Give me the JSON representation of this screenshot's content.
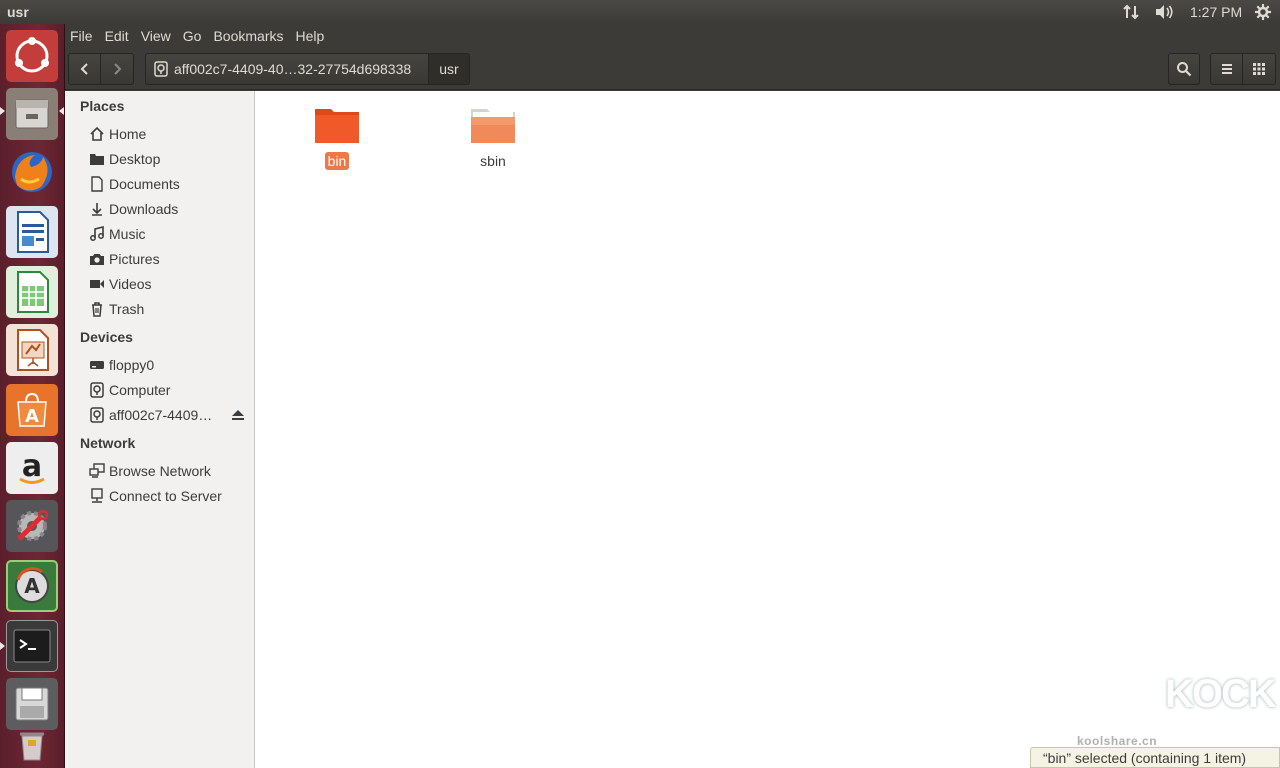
{
  "window": {
    "title": "usr"
  },
  "panel": {
    "clock": "1:27 PM"
  },
  "menu": [
    "File",
    "Edit",
    "View",
    "Go",
    "Bookmarks",
    "Help"
  ],
  "toolbar": {
    "path_root": "aff002c7-4409-40…32-27754d698338",
    "path_current": "usr"
  },
  "sidebar": {
    "places_header": "Places",
    "places": [
      {
        "label": "Home",
        "icon": "home-icon"
      },
      {
        "label": "Desktop",
        "icon": "folder-icon"
      },
      {
        "label": "Documents",
        "icon": "document-icon"
      },
      {
        "label": "Downloads",
        "icon": "download-icon"
      },
      {
        "label": "Music",
        "icon": "music-icon"
      },
      {
        "label": "Pictures",
        "icon": "camera-icon"
      },
      {
        "label": "Videos",
        "icon": "video-icon"
      },
      {
        "label": "Trash",
        "icon": "trash-icon"
      }
    ],
    "devices_header": "Devices",
    "devices": [
      {
        "label": "floppy0",
        "icon": "drive-icon"
      },
      {
        "label": "Computer",
        "icon": "disk-icon"
      },
      {
        "label": "aff002c7-4409…",
        "icon": "disk-icon"
      }
    ],
    "network_header": "Network",
    "network": [
      {
        "label": "Browse Network",
        "icon": "network-icon"
      },
      {
        "label": "Connect to Server",
        "icon": "server-icon"
      }
    ]
  },
  "files": [
    {
      "name": "bin",
      "selected": true,
      "color": "#f05a28"
    },
    {
      "name": "sbin",
      "selected": false,
      "color": "#f08a5a"
    }
  ],
  "status": {
    "text": "“bin” selected  (containing 1 item)"
  },
  "watermark": {
    "url": "koolshare.cn",
    "logo": "KOCK"
  },
  "colors": {
    "accent": "#f07746",
    "launcher": "#6e2734",
    "panel": "#3c3b37"
  }
}
